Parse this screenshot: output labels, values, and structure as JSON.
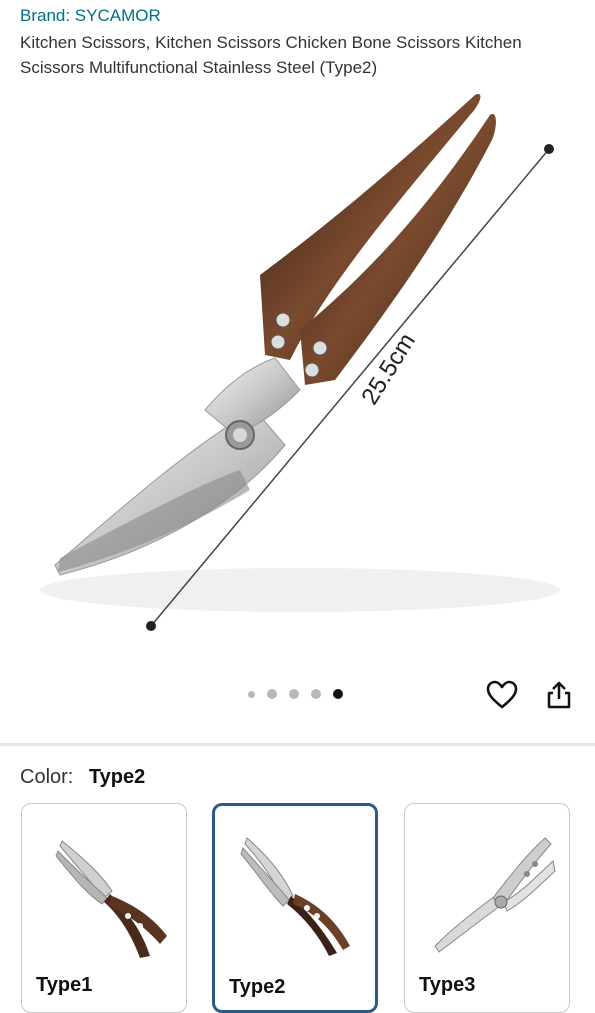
{
  "product": {
    "brand": "Brand: SYCAMOR",
    "title": "Kitchen Scissors, Kitchen Scissors Chicken Bone Scissors Kitchen Scissors Multifunctional Stainless Steel (Type2)"
  },
  "gallery": {
    "dimension_label": "25.5cm",
    "image_count": 5,
    "active_index": 4
  },
  "color": {
    "label": "Color:",
    "selected": "Type2"
  },
  "variants": [
    {
      "label": "Type1"
    },
    {
      "label": "Type2"
    },
    {
      "label": "Type3"
    }
  ],
  "icons": {
    "wishlist": "heart-icon",
    "share": "share-icon"
  },
  "colors": {
    "brand_link": "#007185",
    "selected_border": "#2a5b84",
    "active_dot": "#111111"
  }
}
